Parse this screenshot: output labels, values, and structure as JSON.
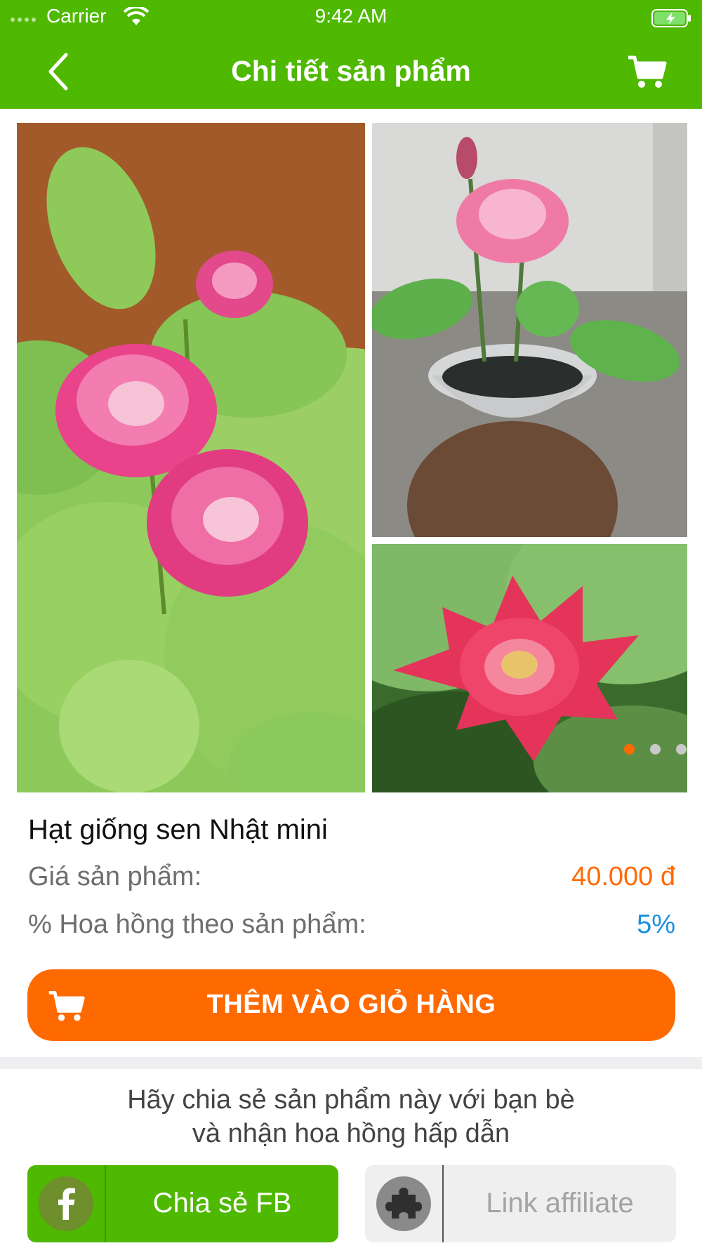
{
  "status_bar": {
    "carrier": "Carrier",
    "time": "9:42 AM"
  },
  "nav": {
    "title": "Chi tiết sản phẩm",
    "back_icon": "chevron-left-icon",
    "cart_icon": "cart-icon"
  },
  "gallery": {
    "images": [
      "lotus-pink-leaves-photo",
      "lotus-bowl-hand-photo",
      "lotus-red-closeup-photo"
    ],
    "page_count": 3,
    "active_page": 1
  },
  "product": {
    "name": "Hạt giống sen Nhật mini",
    "price_label": "Giá sản phẩm:",
    "price_value": "40.000 đ",
    "commission_label": "% Hoa hồng theo sản phẩm:",
    "commission_value": "5%"
  },
  "actions": {
    "add_to_cart": "THÊM VÀO GIỎ HÀNG"
  },
  "share": {
    "line1": "Hãy chia sẻ sản phẩm này với bạn bè",
    "line2": "và nhận hoa hồng hấp dẫn",
    "fb_button": "Chia sẻ FB",
    "affiliate_button": "Link affiliate"
  },
  "colors": {
    "brand_green": "#4fb800",
    "accent_orange": "#ff6a00",
    "commission_blue": "#1a8fe0"
  }
}
